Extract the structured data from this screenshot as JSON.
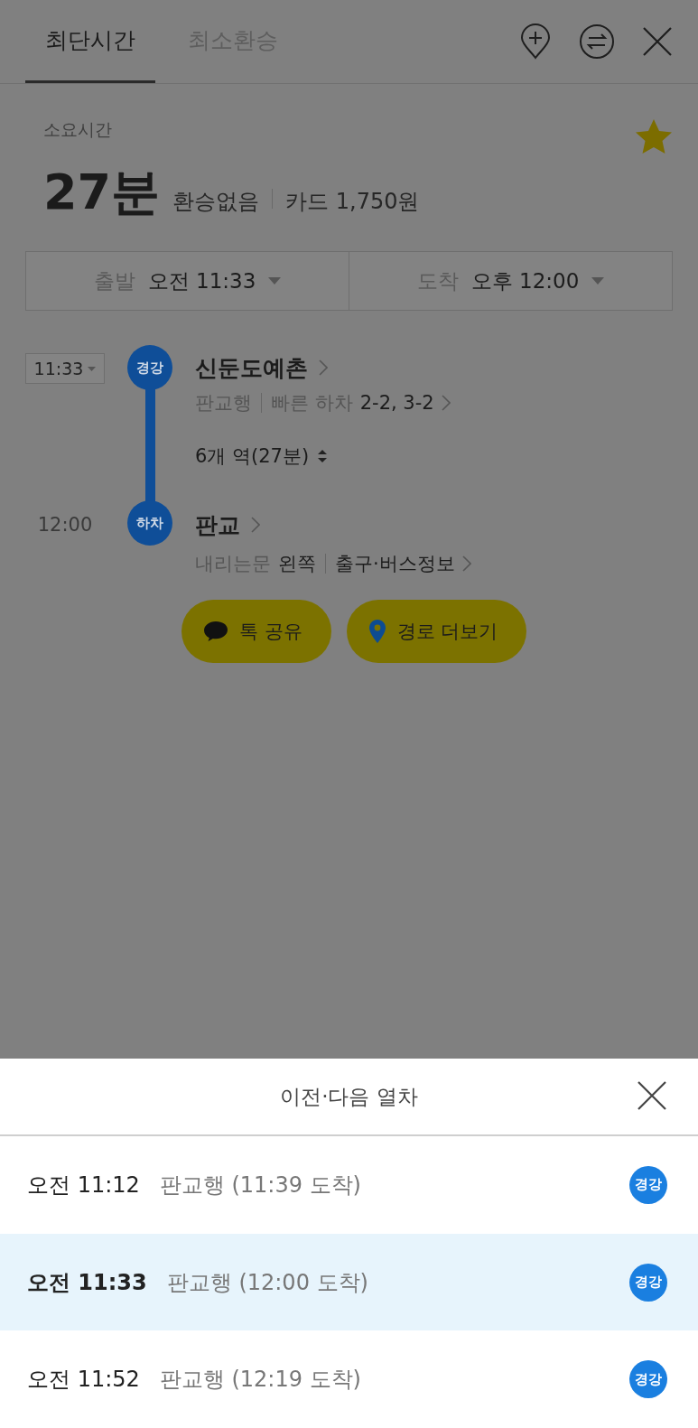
{
  "tabs": [
    {
      "label": "최단시간",
      "selected": true
    },
    {
      "label": "최소환승",
      "selected": false
    }
  ],
  "summary": {
    "label": "소요시간",
    "duration": "27분",
    "transfers": "환승없음",
    "fare": "카드 1,750원",
    "favorite": true
  },
  "times": [
    {
      "label": "출발",
      "value": "오전 11:33"
    },
    {
      "label": "도착",
      "value": "오후 12:00"
    }
  ],
  "route": {
    "board": {
      "time": "11:33",
      "badge": "경강",
      "station": "신둔도예촌",
      "direction": "판교행",
      "fast_label": "빠른 하차",
      "fast_value": "2-2, 3-2"
    },
    "stops": "6개 역(27분)",
    "alight": {
      "time": "12:00",
      "badge": "하차",
      "station": "판교",
      "door_label": "내리는문",
      "door_value": "왼쪽",
      "exit_link": "출구·버스정보"
    }
  },
  "actions": [
    {
      "kind": "talk",
      "label": "톡 공유"
    },
    {
      "kind": "pin",
      "label": "경로 더보기"
    }
  ],
  "sheet": {
    "title": "이전·다음 열차",
    "trains": [
      {
        "time": "오전 11:12",
        "info": "판교행 (11:39 도착)",
        "line": "경강",
        "selected": false
      },
      {
        "time": "오전 11:33",
        "info": "판교행 (12:00 도착)",
        "line": "경강",
        "selected": true
      },
      {
        "time": "오전 11:52",
        "info": "판교행 (12:19 도착)",
        "line": "경강",
        "selected": false
      }
    ]
  }
}
